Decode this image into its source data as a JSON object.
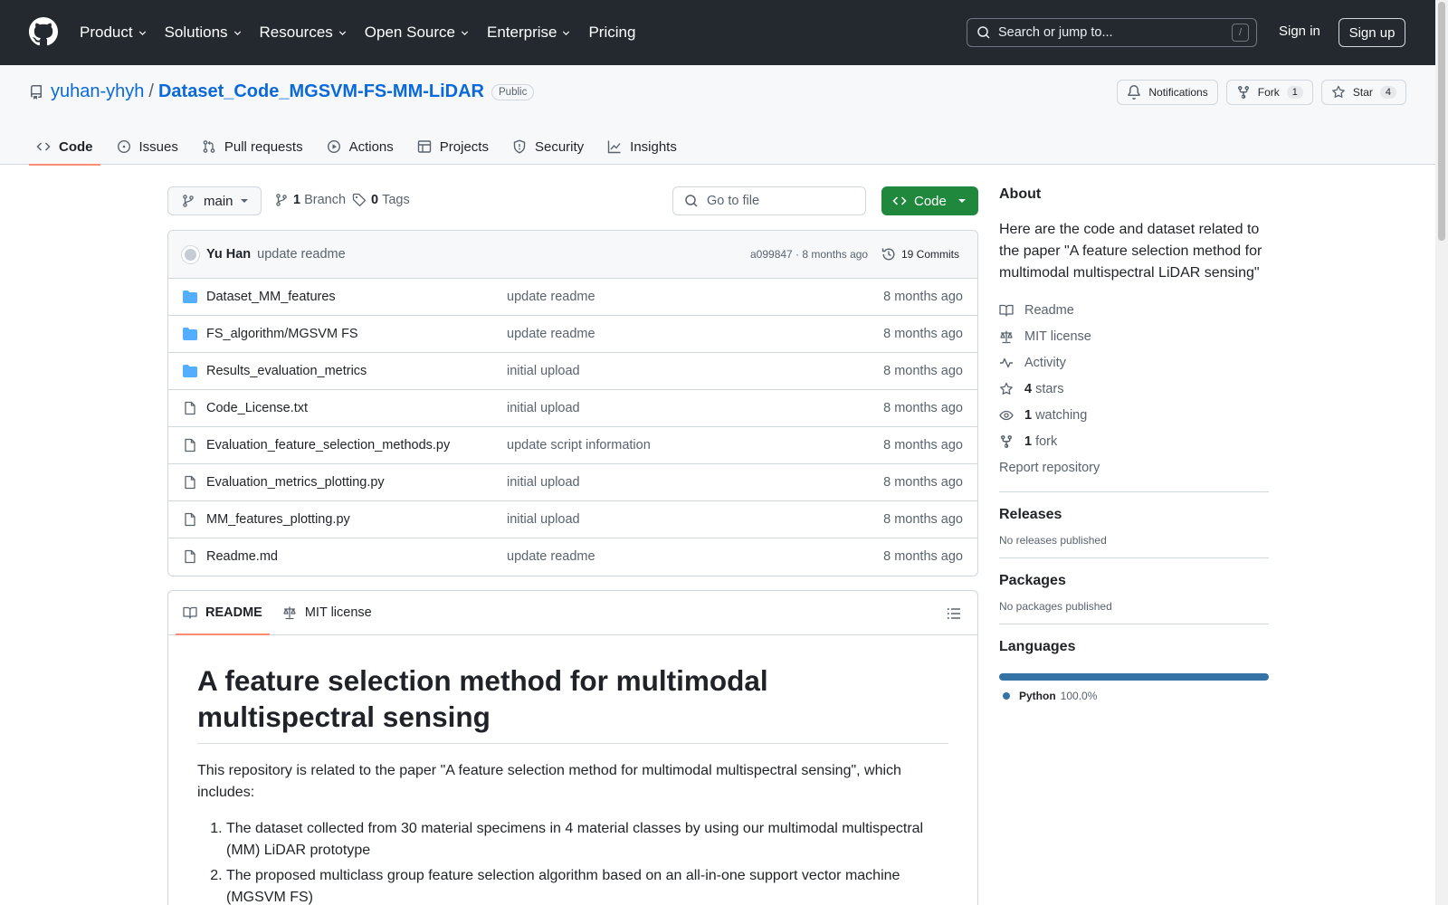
{
  "header": {
    "nav": [
      "Product",
      "Solutions",
      "Resources",
      "Open Source",
      "Enterprise",
      "Pricing"
    ],
    "search_placeholder": "Search or jump to...",
    "search_shortcut": "/",
    "sign_in": "Sign in",
    "sign_up": "Sign up"
  },
  "repo": {
    "owner": "yuhan-yhyh",
    "separator": "/",
    "name": "Dataset_Code_MGSVM-FS-MM-LiDAR",
    "visibility": "Public",
    "notifications_label": "Notifications",
    "fork_label": "Fork",
    "fork_count": "1",
    "star_label": "Star",
    "star_count": "4",
    "tabs": [
      "Code",
      "Issues",
      "Pull requests",
      "Actions",
      "Projects",
      "Security",
      "Insights"
    ]
  },
  "toolbar": {
    "branch": "main",
    "branch_count": "1",
    "branch_label": "Branch",
    "tag_count": "0",
    "tag_label": "Tags",
    "goto_placeholder": "Go to file",
    "code_label": "Code"
  },
  "commit": {
    "author": "Yu Han",
    "message": "update readme",
    "meta": "a099847 · 8 months ago",
    "count_label": "19 Commits"
  },
  "files": [
    {
      "name": "Dataset_MM_features",
      "type": "dir",
      "message": "update readme",
      "age": "8 months ago"
    },
    {
      "name": "FS_algorithm/MGSVM FS",
      "type": "dir",
      "message": "update readme",
      "age": "8 months ago"
    },
    {
      "name": "Results_evaluation_metrics",
      "type": "dir",
      "message": "initial upload",
      "age": "8 months ago"
    },
    {
      "name": "Code_License.txt",
      "type": "file",
      "message": "initial upload",
      "age": "8 months ago"
    },
    {
      "name": "Evaluation_feature_selection_methods.py",
      "type": "file",
      "message": "update script information",
      "age": "8 months ago"
    },
    {
      "name": "Evaluation_metrics_plotting.py",
      "type": "file",
      "message": "initial upload",
      "age": "8 months ago"
    },
    {
      "name": "MM_features_plotting.py",
      "type": "file",
      "message": "initial upload",
      "age": "8 months ago"
    },
    {
      "name": "Readme.md",
      "type": "file",
      "message": "update readme",
      "age": "8 months ago"
    }
  ],
  "readme": {
    "tab_readme": "README",
    "tab_license": "MIT license",
    "title": "A feature selection method for multimodal multispectral sensing",
    "intro": "This repository is related to the paper \"A feature selection method for multimodal multispectral sensing\", which includes:",
    "items": [
      "The dataset collected from 30 material specimens in 4 material classes by using our multimodal multispectral (MM) LiDAR prototype",
      "The proposed multiclass group feature selection algorithm based on an all-in-one support vector machine (MGSVM FS)"
    ]
  },
  "about": {
    "title": "About",
    "description": "Here are the code and dataset related to the paper \"A feature selection method for multimodal multispectral LiDAR sensing\"",
    "readme": "Readme",
    "license": "MIT license",
    "activity": "Activity",
    "stars_count": "4",
    "stars_label": "stars",
    "watching_count": "1",
    "watching_label": "watching",
    "fork_count": "1",
    "fork_label": "fork",
    "report": "Report repository"
  },
  "releases": {
    "title": "Releases",
    "empty": "No releases published"
  },
  "packages": {
    "title": "Packages",
    "empty": "No packages published"
  },
  "languages": {
    "title": "Languages",
    "items": [
      {
        "name": "Python",
        "percent": "100.0%",
        "color": "#3572a5"
      }
    ]
  },
  "colors": {
    "header_bg": "#24292f",
    "link": "#0969da",
    "primary_button": "#1f883d",
    "tab_underline": "#fd8c73",
    "folder": "#54aeff"
  }
}
